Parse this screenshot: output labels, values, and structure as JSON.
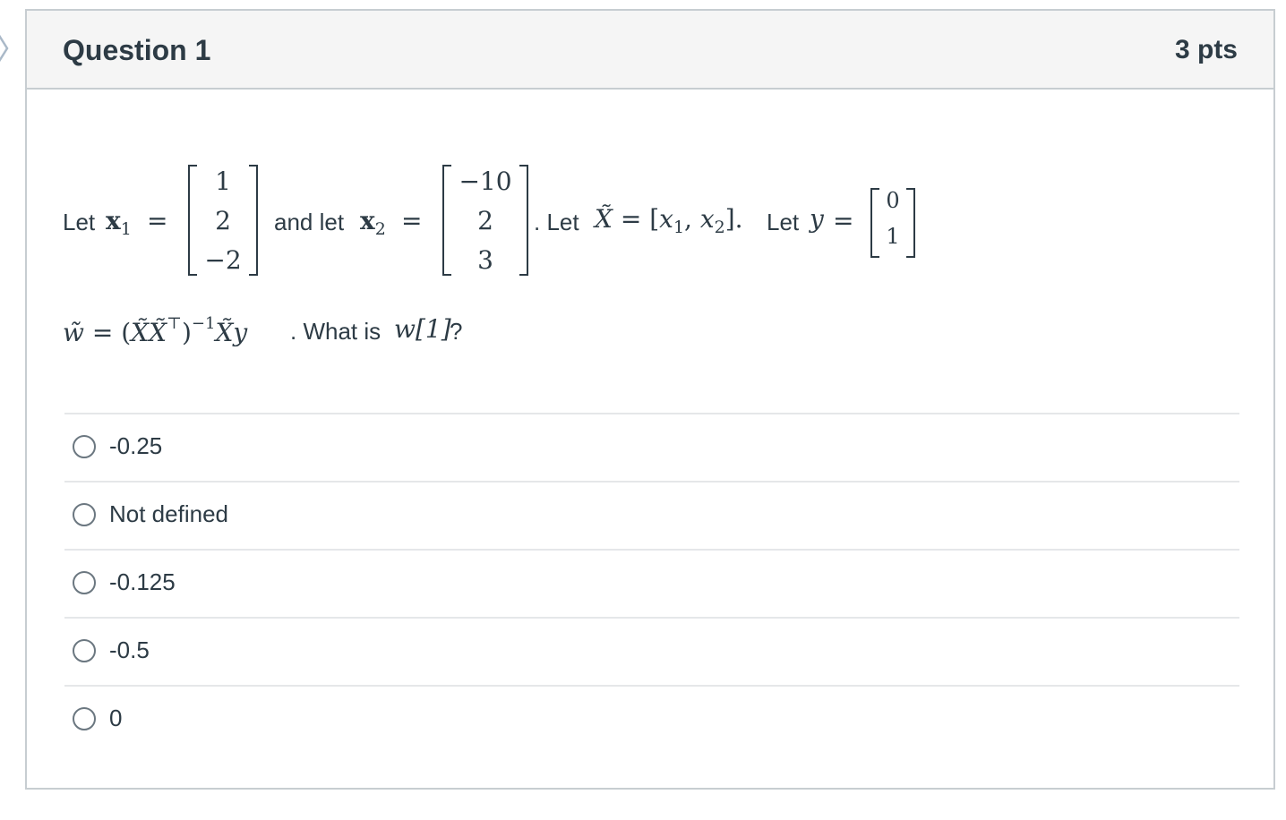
{
  "question": {
    "title": "Question 1",
    "points": "3 pts"
  },
  "prompt": {
    "let1": "Let",
    "x1_symbol": "x",
    "x1_sub": "1",
    "equals": "=",
    "x1_values": [
      "1",
      "2",
      "−2"
    ],
    "and_let": "and let",
    "x2_symbol": "x",
    "x2_sub": "2",
    "x2_values": [
      "−10",
      "2",
      "3"
    ],
    "let_X": ". Let",
    "X_def": "X̃ = [x₁, x₂].",
    "X_tilde": "X̃",
    "X_def_rhs": "= [",
    "x1_small": "x",
    "x2_small": "x",
    "comma": ", ",
    "close_bracket": "].",
    "let_y": "Let",
    "y_symbol": "y",
    "y_values": [
      "0",
      "1"
    ],
    "w_tilde": "w̃",
    "eq2": " = (",
    "XX": "X̃X̃",
    "transpose": "⊤",
    "close_paren": ")",
    "inverse": "−1",
    "Xy": "X̃y",
    "what_is": ". What is",
    "w_index": "w[1]",
    "question_mark": "?"
  },
  "options": [
    {
      "label": "-0.25"
    },
    {
      "label": "Not defined"
    },
    {
      "label": "-0.125"
    },
    {
      "label": "-0.5"
    },
    {
      "label": "0"
    }
  ]
}
